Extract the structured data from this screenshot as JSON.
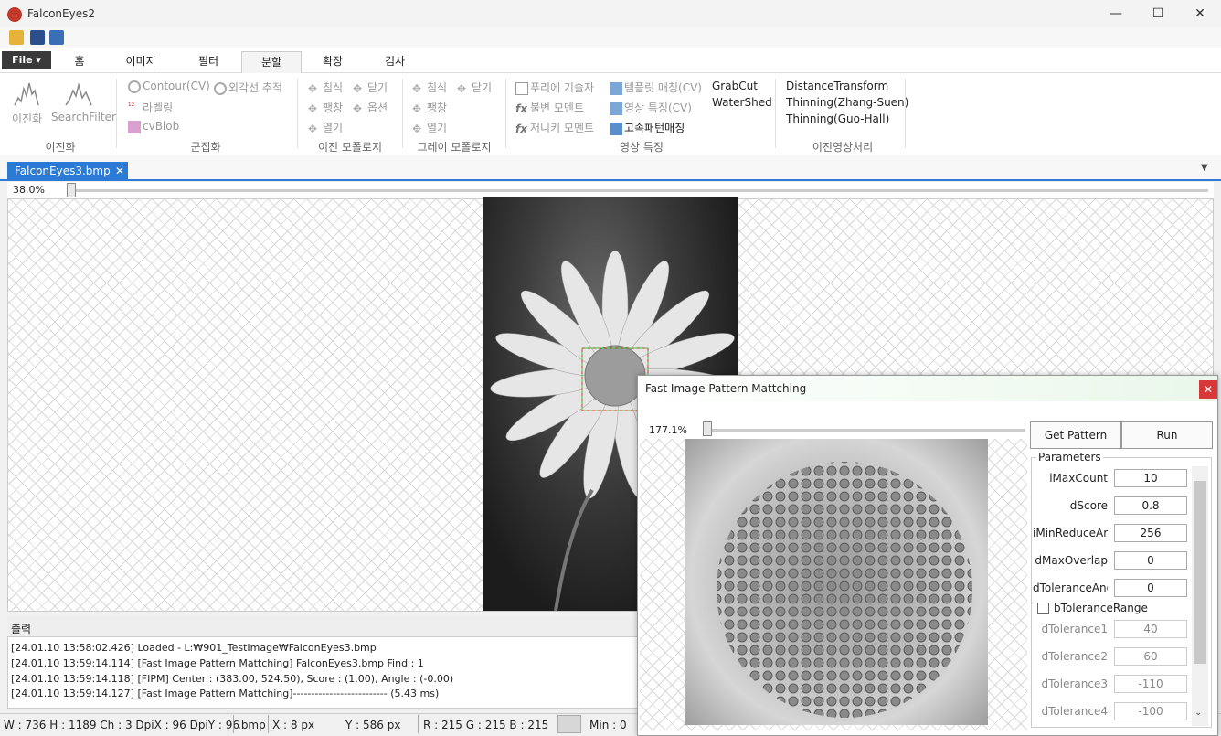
{
  "window": {
    "title": "FalconEyes2",
    "min": "—",
    "max": "☐",
    "close": "✕"
  },
  "menu": {
    "file": "File ▾",
    "tabs": [
      "홈",
      "이미지",
      "필터",
      "분할",
      "확장",
      "검사"
    ],
    "active_tab": "분할"
  },
  "ribbon": {
    "binarize": {
      "items": [
        "이진화",
        "SearchFilter"
      ],
      "group": "이진화"
    },
    "cluster": {
      "items": [
        "Contour(CV)",
        "외각선 추적",
        "라벨링",
        "cvBlob"
      ],
      "group": "군집화"
    },
    "binary_morph": {
      "items": [
        "침식",
        "닫기",
        "팽창",
        "옵션",
        "열기"
      ],
      "group": "이진 모폴로지"
    },
    "gray_morph": {
      "items": [
        "침식",
        "닫기",
        "팽창",
        "열기"
      ],
      "group": "그레이 모폴로지"
    },
    "features": {
      "items": [
        "푸리에 기술자",
        "템플릿 매칭(CV)",
        "불변 모멘트",
        "영상 특징(CV)",
        "저니키 모멘트",
        "고속패턴매칭",
        "GrabCut",
        "WaterShed"
      ],
      "group": "영상 특징"
    },
    "binary_proc": {
      "items": [
        "DistanceTransform",
        "Thinning(Zhang-Suen)",
        "Thinning(Guo-Hall)"
      ],
      "group": "이진영상처리"
    }
  },
  "document": {
    "tab": "FalconEyes3.bmp",
    "zoom": "38.0%"
  },
  "output": {
    "title": "출력",
    "lines": [
      "[24.01.10 13:58:02.426] Loaded - L:₩901_TestImage₩FalconEyes3.bmp",
      "[24.01.10 13:59:14.114] [Fast Image Pattern Mattching] FalconEyes3.bmp Find : 1",
      "[24.01.10 13:59:14.118] [FIPM] Center : (383.00, 524.50), Score : (1.00), Angle : (-0.00)",
      "[24.01.10 13:59:14.127] [Fast Image Pattern Mattching]-------------------------- (5.43 ms)"
    ]
  },
  "status": {
    "size": "W : 736  H : 1189  Ch : 3  DpiX : 96  DpiY : 96",
    "ext": ".bmp",
    "x": "X :        8 px",
    "y": "Y :     586 px",
    "rgb": "R :  215  G :  215  B :  215",
    "min": "Min :   0"
  },
  "dialog": {
    "title": "Fast Image Pattern Mattching",
    "zoom": "177.1%",
    "get_pattern": "Get Pattern",
    "run": "Run",
    "params_title": "Parameters",
    "params": [
      {
        "label": "iMaxCount",
        "value": "10"
      },
      {
        "label": "dScore",
        "value": "0.8"
      },
      {
        "label": "iMinReduceArea",
        "value": "256"
      },
      {
        "label": "dMaxOverlap",
        "value": "0"
      },
      {
        "label": "dToleranceAngle",
        "value": "0"
      }
    ],
    "checkbox": "bToleranceRange",
    "tolerances": [
      {
        "label": "dTolerance1",
        "value": "40"
      },
      {
        "label": "dTolerance2",
        "value": "60"
      },
      {
        "label": "dTolerance3",
        "value": "-110"
      },
      {
        "label": "dTolerance4",
        "value": "-100"
      }
    ]
  }
}
